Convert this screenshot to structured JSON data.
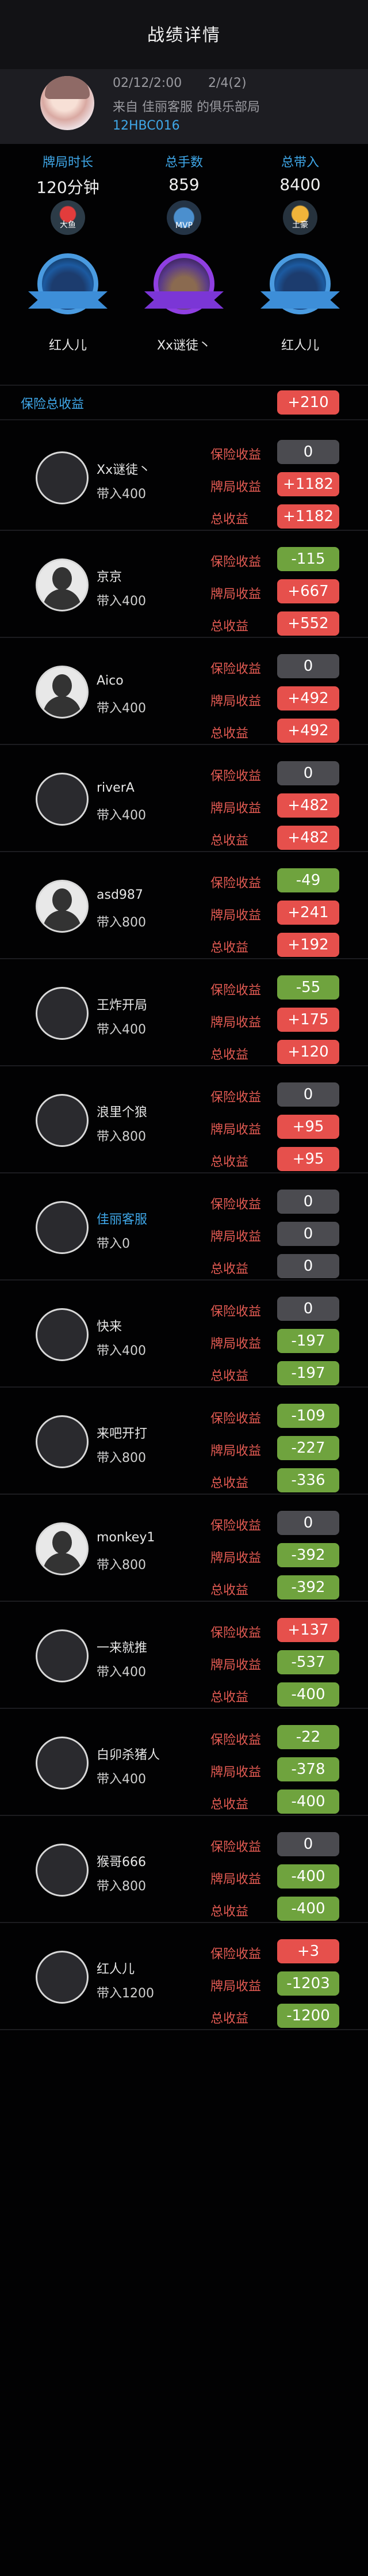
{
  "header": {
    "title": "战绩详情"
  },
  "game": {
    "date": "02/12/2:00",
    "date2": "2/4(2)",
    "from": "来自 佳丽客服 的俱乐部局",
    "code": "12HBC016"
  },
  "stats": [
    {
      "label": "牌局时长",
      "value": "120分钟",
      "badge": "大鱼"
    },
    {
      "label": "总手数",
      "value": "859",
      "badge": "MVP"
    },
    {
      "label": "总带入",
      "value": "8400",
      "badge": "土豪"
    }
  ],
  "awards": [
    {
      "name": "红人儿"
    },
    {
      "name": "Xx谜徒丶"
    },
    {
      "name": "红人儿"
    }
  ],
  "insurance_total": {
    "label": "保险总收益",
    "value": "+210"
  },
  "row_labels": {
    "insurance": "保险收益",
    "hand": "牌局收益",
    "total": "总收益"
  },
  "players": [
    {
      "name": "Xx谜徒丶",
      "bring": "带入400",
      "insurance": "0",
      "hand": "+1182",
      "total": "+1182"
    },
    {
      "name": "京京",
      "bring": "带入400",
      "insurance": "-115",
      "hand": "+667",
      "total": "+552"
    },
    {
      "name": "Aico",
      "bring": "带入400",
      "insurance": "0",
      "hand": "+492",
      "total": "+492"
    },
    {
      "name": "riverA",
      "bring": "带入400",
      "insurance": "0",
      "hand": "+482",
      "total": "+482"
    },
    {
      "name": "asd987",
      "bring": "带入800",
      "insurance": "-49",
      "hand": "+241",
      "total": "+192"
    },
    {
      "name": "王炸开局",
      "bring": "带入400",
      "insurance": "-55",
      "hand": "+175",
      "total": "+120"
    },
    {
      "name": "浪里个狼",
      "bring": "带入800",
      "insurance": "0",
      "hand": "+95",
      "total": "+95"
    },
    {
      "name": "佳丽客服",
      "bring": "带入0",
      "insurance": "0",
      "hand": "0",
      "total": "0"
    },
    {
      "name": "快来",
      "bring": "带入400",
      "insurance": "0",
      "hand": "-197",
      "total": "-197"
    },
    {
      "name": "来吧开打",
      "bring": "带入800",
      "insurance": "-109",
      "hand": "-227",
      "total": "-336"
    },
    {
      "name": "monkey1",
      "bring": "带入800",
      "insurance": "0",
      "hand": "-392",
      "total": "-392"
    },
    {
      "name": "一来就推",
      "bring": "带入400",
      "insurance": "+137",
      "hand": "-537",
      "total": "-400"
    },
    {
      "name": "白卯杀猪人",
      "bring": "带入400",
      "insurance": "-22",
      "hand": "-378",
      "total": "-400"
    },
    {
      "name": "猴哥666",
      "bring": "带入800",
      "insurance": "0",
      "hand": "-400",
      "total": "-400"
    },
    {
      "name": "红人儿",
      "bring": "带入1200",
      "insurance": "+3",
      "hand": "-1203",
      "total": "-1200"
    }
  ],
  "colors": {
    "accent_blue": "#3fa7e8",
    "positive": "#e6504c",
    "negative": "#6fa33e",
    "zero": "#4b4b50"
  }
}
